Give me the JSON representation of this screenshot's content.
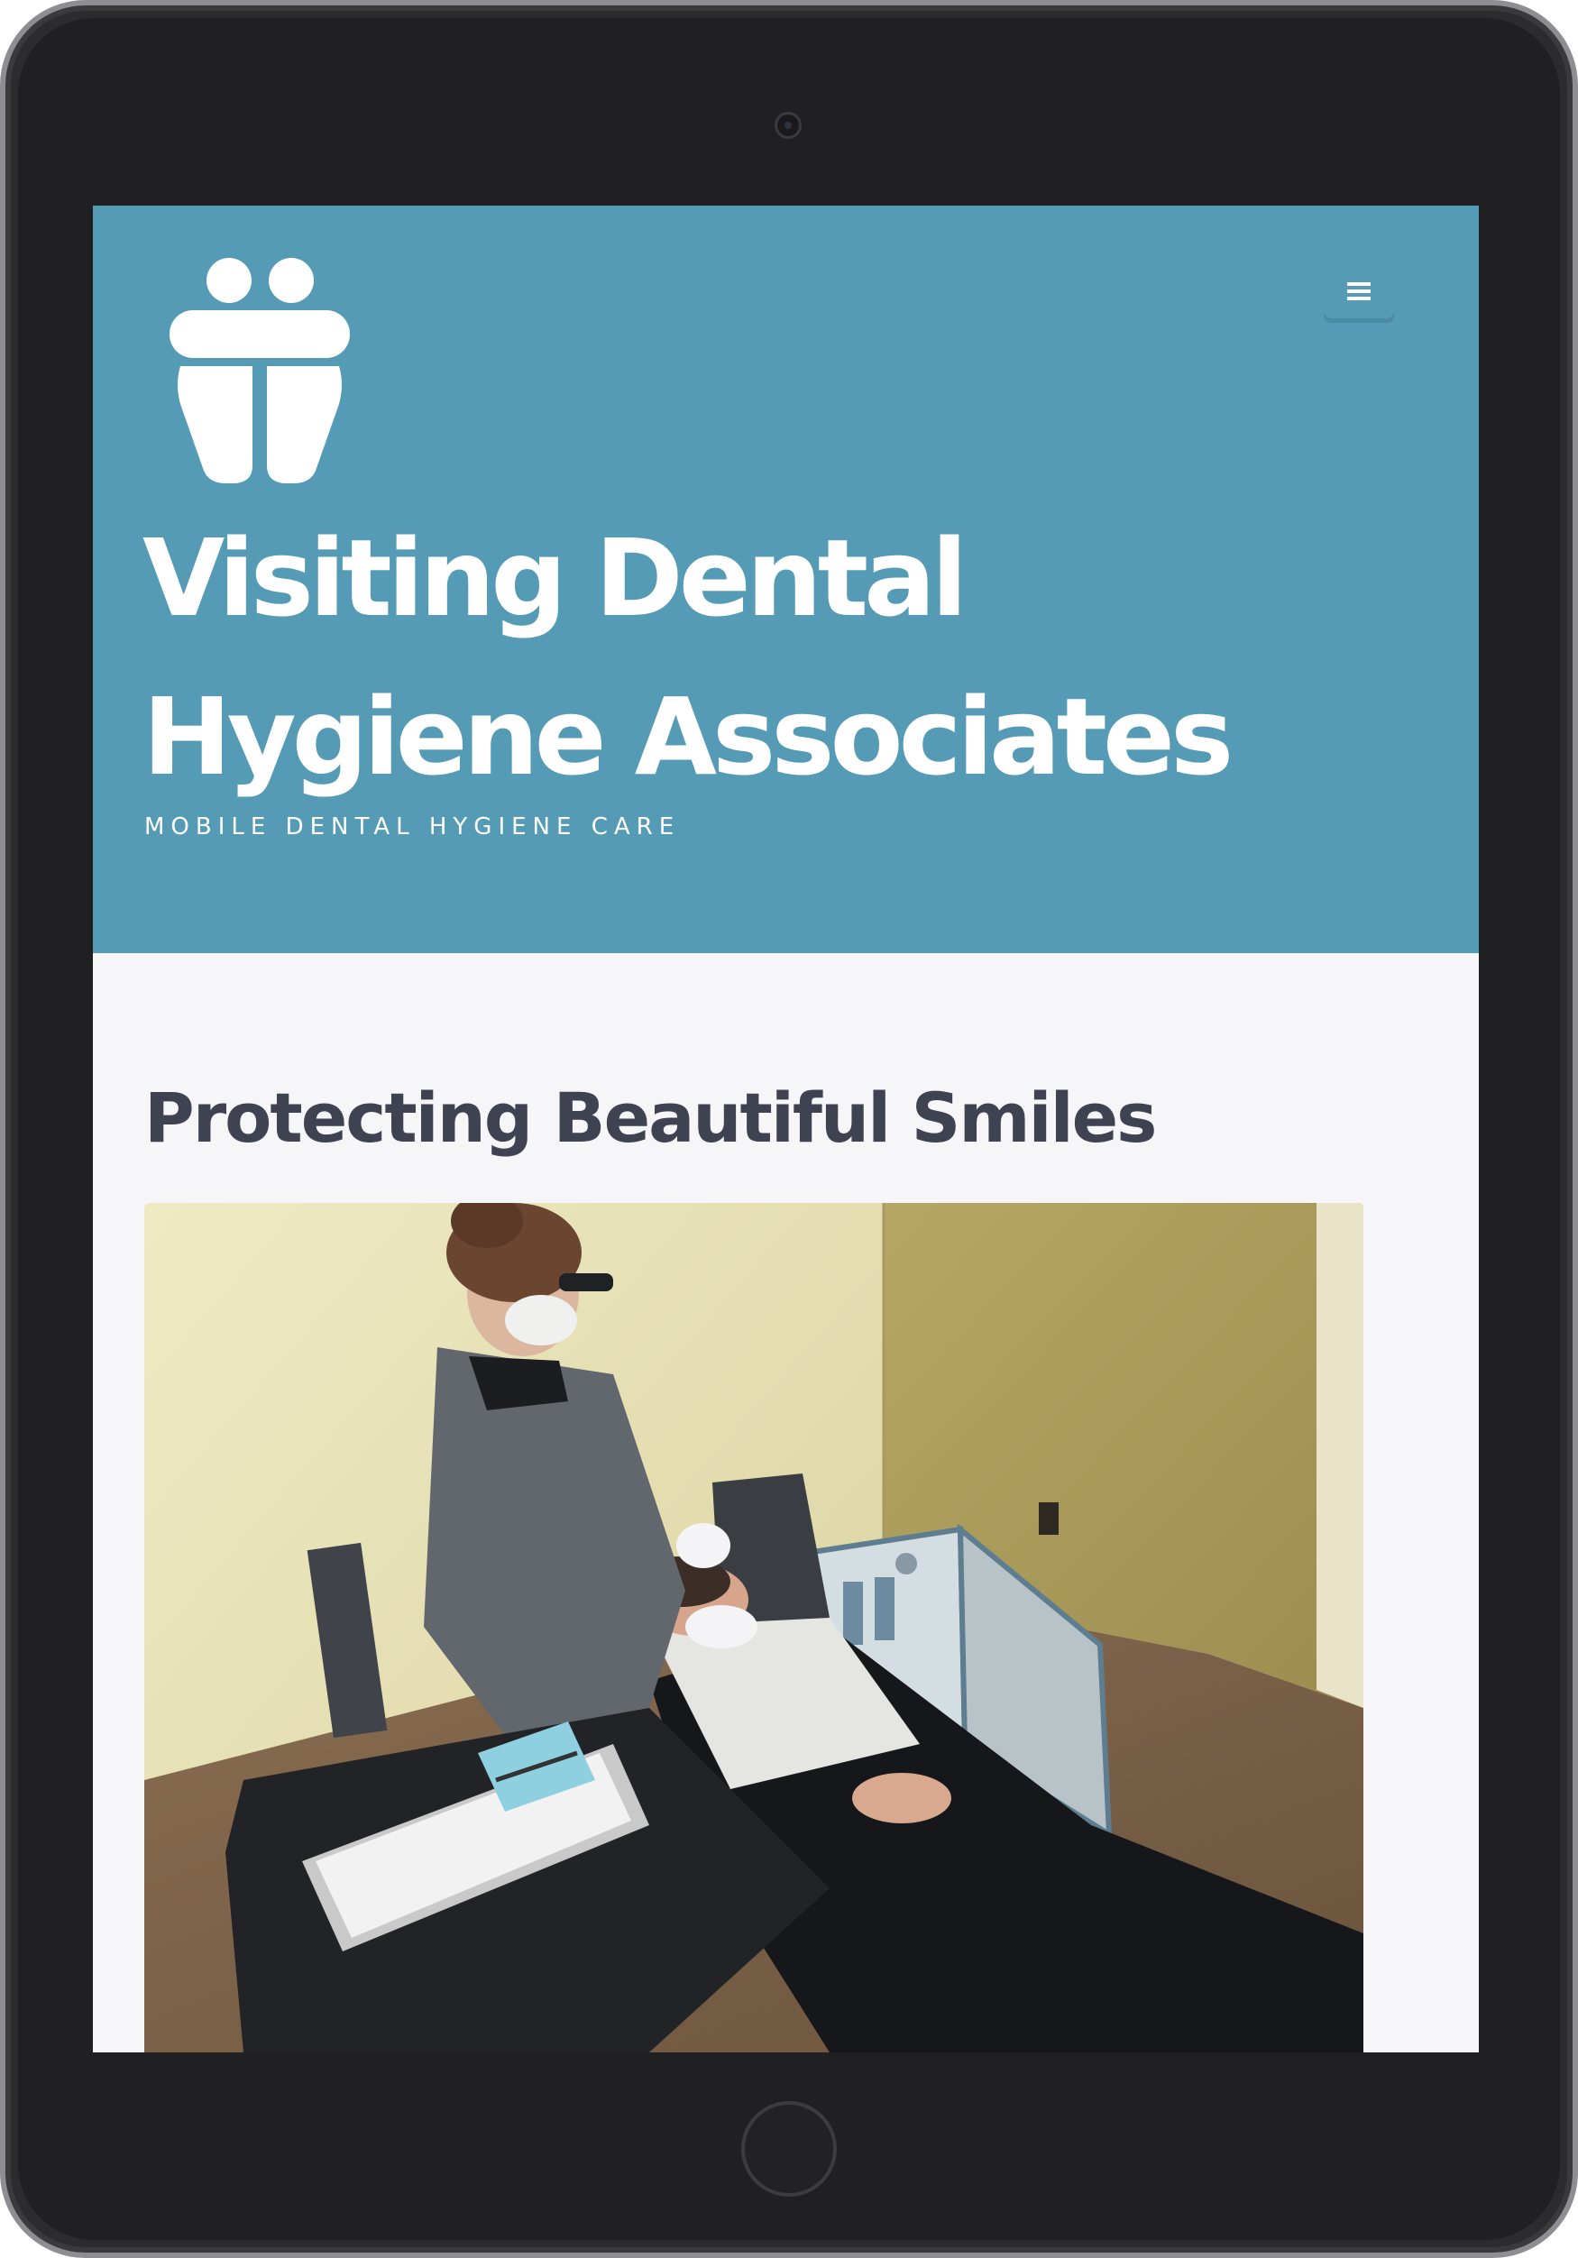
{
  "site": {
    "title": "Visiting Dental Hygiene Associates",
    "tagline": "MOBILE DENTAL HYGIENE CARE",
    "logo_icon": "tooth-figures-icon",
    "brand_color": "#559bb5"
  },
  "header": {
    "menu_icon": "hamburger-menu-icon"
  },
  "main": {
    "heading": "Protecting Beautiful Smiles",
    "photo_subject": "hygienist-treating-patient-photo"
  },
  "colors": {
    "header_bg": "#559bb5",
    "page_bg": "#f6f6f8",
    "heading_text": "#3e4251",
    "device_frame": "#202022"
  }
}
